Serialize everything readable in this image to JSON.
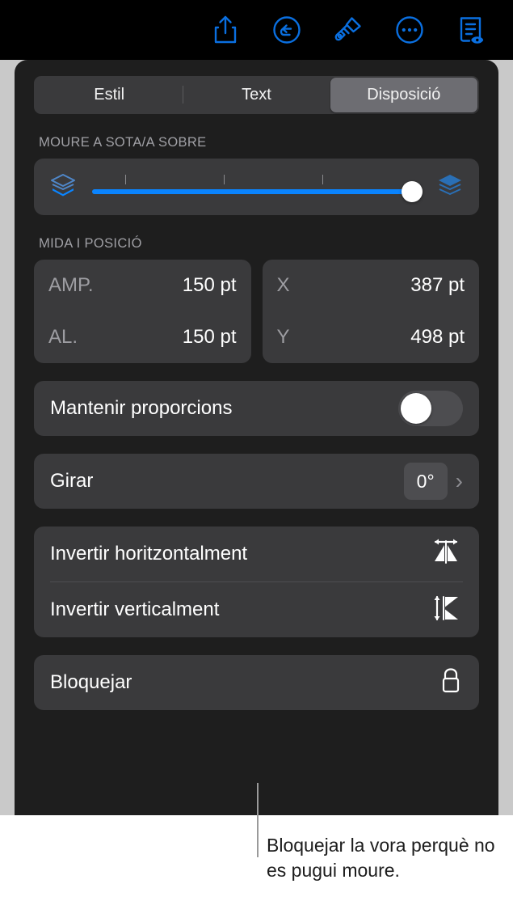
{
  "toolbar": {
    "buttons": [
      {
        "name": "share-icon",
        "label": "Comparteix"
      },
      {
        "name": "undo-icon",
        "label": "Desfés"
      },
      {
        "name": "brush-icon",
        "label": "Format"
      },
      {
        "name": "more-icon",
        "label": "Més"
      },
      {
        "name": "document-view-icon",
        "label": "Document"
      }
    ]
  },
  "tabs": [
    {
      "label": "Estil",
      "selected": false
    },
    {
      "label": "Text",
      "selected": false
    },
    {
      "label": "Disposició",
      "selected": true
    }
  ],
  "arrange": {
    "section_label": "MOURE A SOTA/A SOBRE",
    "slider_value": 100,
    "slider_min": 0,
    "slider_max": 100,
    "tick_positions": [
      10,
      40,
      70
    ],
    "back_icon": "send-to-back-icon",
    "front_icon": "bring-to-front-icon"
  },
  "size_position": {
    "section_label": "MIDA I POSICIÓ",
    "size": [
      {
        "key": "AMP.",
        "value": "150 pt"
      },
      {
        "key": "AL.",
        "value": "150 pt"
      }
    ],
    "position": [
      {
        "key": "X",
        "value": "387 pt"
      },
      {
        "key": "Y",
        "value": "498 pt"
      }
    ]
  },
  "constrain": {
    "label": "Mantenir proporcions",
    "enabled": false
  },
  "rotate": {
    "label": "Girar",
    "value": "0°",
    "chevron": "›"
  },
  "flip": {
    "horizontal_label": "Invertir horitzontalment",
    "vertical_label": "Invertir verticalment"
  },
  "lock": {
    "label": "Bloquejar"
  },
  "callout": {
    "text": "Bloquejar la vora perquè no es pugui moure."
  },
  "colors": {
    "accent": "#0a84ff",
    "panel": "#1e1e1e",
    "card": "#3a3a3c",
    "selected_segment": "#6d6d72",
    "backdrop": "#c9c9c9"
  }
}
